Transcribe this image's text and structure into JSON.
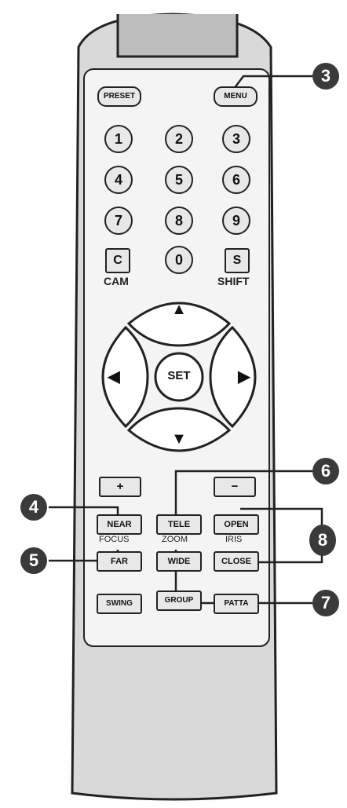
{
  "top_buttons": {
    "preset": "PRESET",
    "menu": "MENU"
  },
  "digits": [
    "1",
    "2",
    "3",
    "4",
    "5",
    "6",
    "7",
    "8",
    "9"
  ],
  "cam": {
    "key": "C",
    "label": "CAM"
  },
  "zero": "0",
  "shift": {
    "key": "S",
    "label": "SHIFT"
  },
  "dpad": {
    "up": "▲",
    "down": "▼",
    "left": "◀",
    "right": "▶",
    "set": "SET"
  },
  "plus": "+",
  "minus": "−",
  "lens": {
    "near": "NEAR",
    "far": "FAR",
    "focus_label": "FOCUS",
    "tele": "TELE",
    "wide": "WIDE",
    "zoom_label": "ZOOM",
    "open": "OPEN",
    "close": "CLOSE",
    "iris_label": "IRIS"
  },
  "bottom": {
    "swing": "SWING",
    "group": "GROUP",
    "patta": "PATTA"
  },
  "callouts": {
    "c3": "3",
    "c4": "4",
    "c5": "5",
    "c6": "6",
    "c7": "7",
    "c8": "8"
  }
}
